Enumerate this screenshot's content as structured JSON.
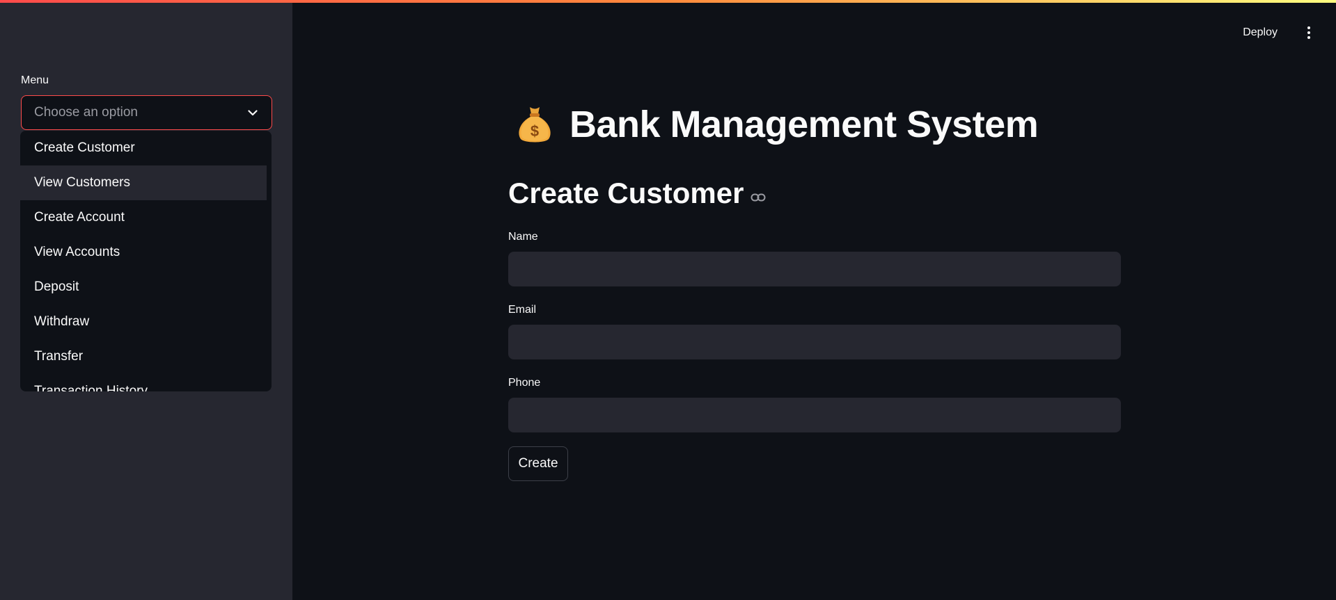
{
  "header": {
    "deploy_label": "Deploy"
  },
  "sidebar": {
    "menu_label": "Menu",
    "select": {
      "placeholder": "Choose an option"
    },
    "options": [
      "Create Customer",
      "View Customers",
      "Create Account",
      "View Accounts",
      "Deposit",
      "Withdraw",
      "Transfer",
      "Transaction History"
    ]
  },
  "main": {
    "title": "Bank Management System",
    "section_title": "Create Customer",
    "fields": {
      "name_label": "Name",
      "email_label": "Email",
      "phone_label": "Phone"
    },
    "create_label": "Create"
  },
  "colors": {
    "accent": "#ff4b4b",
    "background": "#0e1117",
    "sidebar": "#262730"
  }
}
